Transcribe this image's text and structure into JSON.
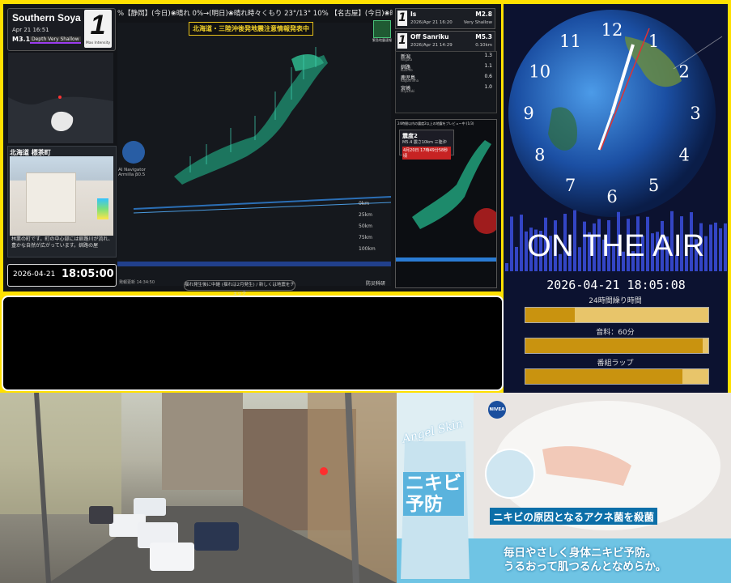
{
  "quake": {
    "ticker": "%【静岡】(今日)❀晴れ 0%→(明日)❀晴れ時々くもり 23°/13° 10% 【名古屋】(今日)❀晴れ 0%→(明日):",
    "epicenter": {
      "name": "Southern Soya",
      "time": "Apr 21 16:51",
      "magnitude": "M3.1",
      "depth": "Depth Very Shallow",
      "intensity": "1",
      "intensity_label": "Max Intensity"
    },
    "city": {
      "title": "北海道 標茶町",
      "description": "林業の町です。町の中心部には釧路川が流れ、豊かな自然が広がっています。釧路の屋"
    },
    "clock": {
      "date": "2026-04-21",
      "time": "18:05:00"
    },
    "banner": "北海道・三陸沖後発地震注意情報発表中",
    "legend_logo": "緊急地震速報",
    "ai_label": "AI Navigator\nArmilla β0.5",
    "scale": [
      "0km",
      "25km",
      "50km",
      "75km",
      "100km"
    ],
    "footer_time": "発報更新 14:34:50",
    "footer_button": "揺れ発生後に中継 (揺れは2月発生) / 新しくは地震をチェック",
    "nied": "防災科研",
    "recent": [
      {
        "intensity": "1",
        "name": "Is",
        "time": "2026/Apr 21 16:20",
        "mag": "M2.8",
        "depth": "Very Shallow"
      },
      {
        "intensity": "1",
        "name": "Off Sanriku",
        "time": "2026/Apr 21 14:29",
        "mag": "M5.3",
        "depth": "0.10km"
      }
    ],
    "stations": [
      {
        "name": "新潟",
        "sub": "Niigata",
        "value": "1.3"
      },
      {
        "name": "釧路",
        "sub": "Kushiro",
        "value": "1.1"
      },
      {
        "name": "鹿児島",
        "sub": "Kagoshima",
        "value": "0.6"
      },
      {
        "name": "宮崎",
        "sub": "Miyazaki",
        "value": "1.0"
      }
    ],
    "mini_map": {
      "header": "24時間以内の震度2以上の地震をプレビュー中 (1/3)",
      "title": "震度2",
      "detail": "M5.4 震さ10km 三陸沖",
      "red_line": "4月20日 17時49分58秒頃"
    }
  },
  "right_panel": {
    "clock_numbers": [
      "12",
      "1",
      "2",
      "3",
      "4",
      "5",
      "6",
      "7",
      "8",
      "9",
      "10",
      "11"
    ],
    "on_air": "ON THE AIR",
    "datetime": "2026-04-21 18:05:08",
    "bars": [
      {
        "label": "24時間繰り時間",
        "fill": 0.27
      },
      {
        "label": "音料：60分",
        "fill": 0.97
      },
      {
        "label": "番組ラップ",
        "fill": 0.86
      }
    ]
  },
  "camera": {
    "datetime": ""
  },
  "ad": {
    "brand": "Angel Skin",
    "logo": "NIVEA",
    "product": "ニキビ\n予防",
    "line1": "ニキビの原因となるアクネ菌を殺菌",
    "line2": "毎日やさしく身体ニキビ予防。\nうるおって肌つるんとなめらか。"
  }
}
